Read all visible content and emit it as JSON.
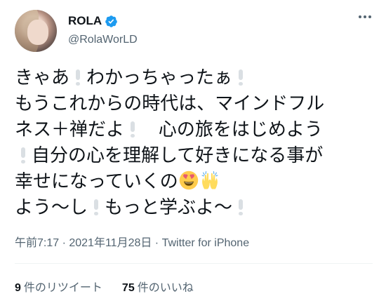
{
  "user": {
    "display_name": "ROLA",
    "handle": "@RolaWorLD",
    "verified_color": "#1d9bf0"
  },
  "tweet": {
    "line1_a": "きゃあ",
    "line1_b": "わかっちゃったぁ",
    "line2": "もうこれからの時代は、マインドフル",
    "line3_a": "ネス＋禅だよ",
    "line3_b": "心の旅をはじめよう",
    "line4": "自分の心を理解して好きになる事が",
    "line5": "幸せになっていくの",
    "line6_a": "よう〜し",
    "line6_b": "もっと学ぶよ〜",
    "emoji_heart_eyes": "heart-eyes-face-emoji",
    "emoji_raised_hands": "raised-hands-emoji",
    "excl_icon": "white-exclamation-emoji"
  },
  "meta": {
    "time": "午前7:17 · 2021年11月28日 · ",
    "source": "Twitter for iPhone"
  },
  "stats": {
    "retweets_count": "9",
    "retweets_label": "件のリツイート",
    "likes_count": "75",
    "likes_label": "件のいいね"
  }
}
